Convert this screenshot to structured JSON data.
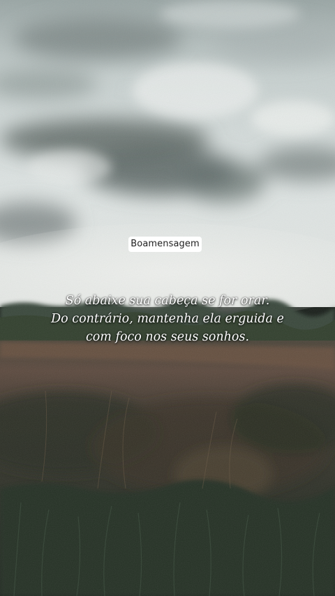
{
  "watermark": {
    "label": "Boamensagem"
  },
  "quote": {
    "lines": [
      "Só abaixe sua cabeça se for orar.",
      "Do contrário, mantenha ela erguida e",
      "com foco nos seus sonhos."
    ]
  },
  "colors": {
    "sky_light": "#d9e0df",
    "cloud_dark": "#6b7573",
    "treeline": "#3a4a3e",
    "field_band": "#5b4a3e",
    "grass_dark": "#283228",
    "text": "#ffffff"
  }
}
